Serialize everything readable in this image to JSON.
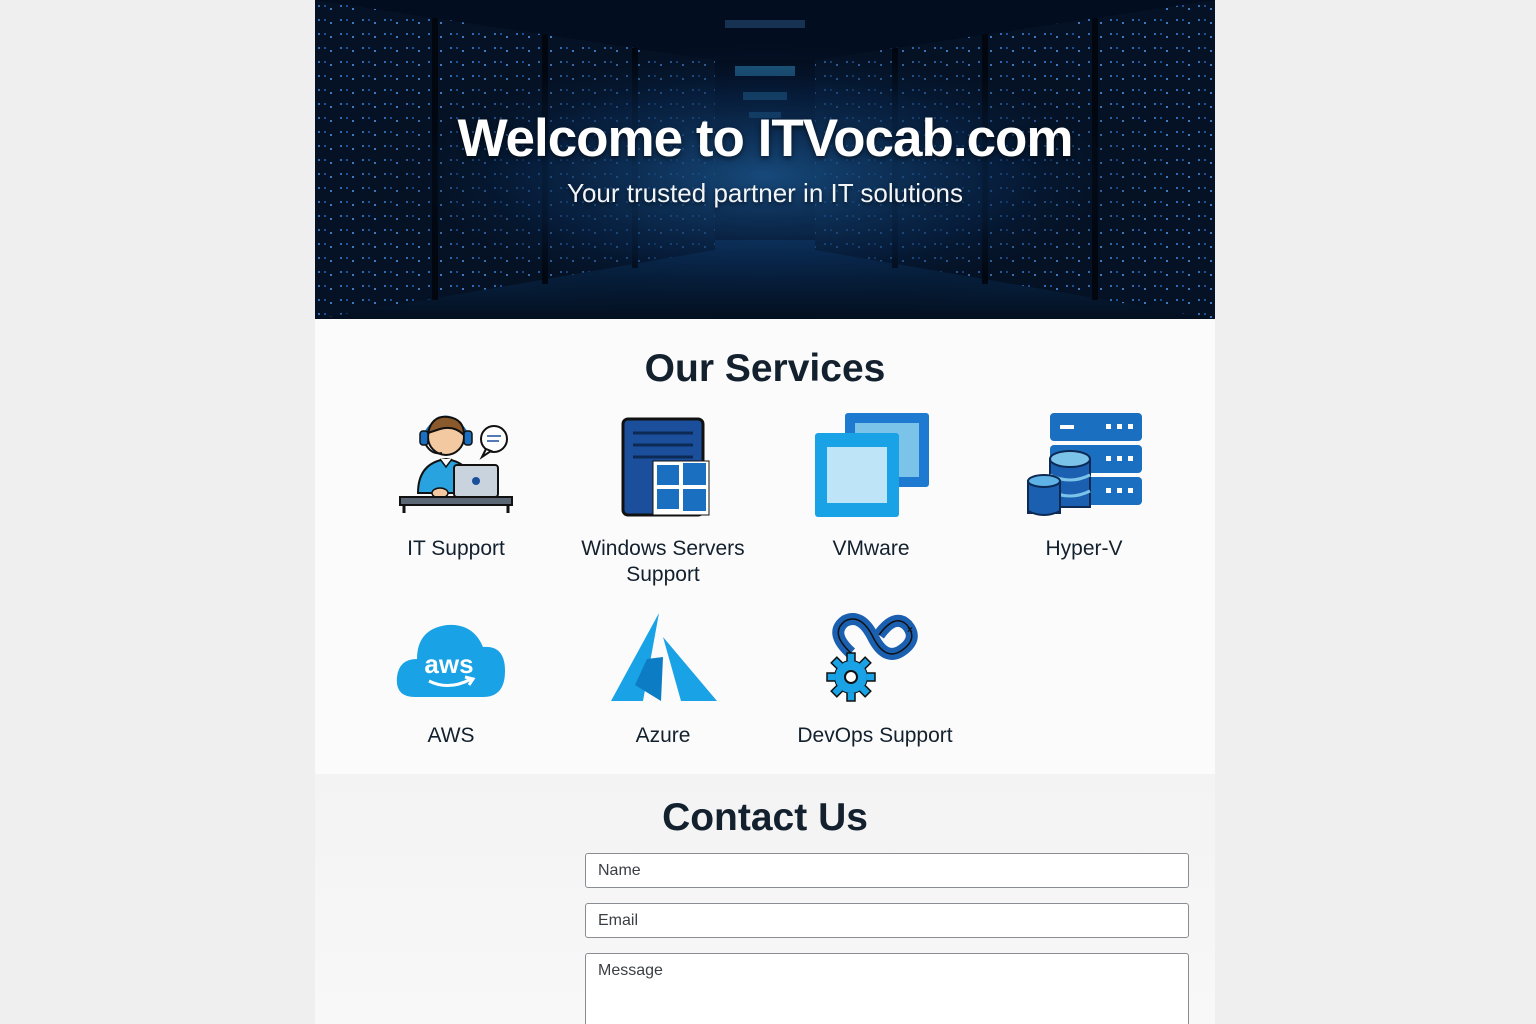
{
  "hero": {
    "title": "Welcome to ITVocab.com",
    "subtitle": "Your trusted partner in IT solutions"
  },
  "services": {
    "heading": "Our Services",
    "items": [
      {
        "label": "IT Support",
        "icon": "support-agent-icon"
      },
      {
        "label": "Windows Servers Support",
        "icon": "windows-server-icon"
      },
      {
        "label": "VMware",
        "icon": "vmware-icon"
      },
      {
        "label": "Hyper-V",
        "icon": "hyperv-server-icon"
      },
      {
        "label": "AWS",
        "icon": "aws-cloud-icon"
      },
      {
        "label": "Azure",
        "icon": "azure-icon"
      },
      {
        "label": "DevOps Support",
        "icon": "devops-gear-icon"
      }
    ]
  },
  "contact": {
    "heading": "Contact Us",
    "name_placeholder": "Name",
    "email_placeholder": "Email",
    "message_placeholder": "Message"
  },
  "colors": {
    "accent_blue": "#1aa3e8",
    "dark_blue": "#1b4f9c",
    "heading": "#13202e"
  }
}
